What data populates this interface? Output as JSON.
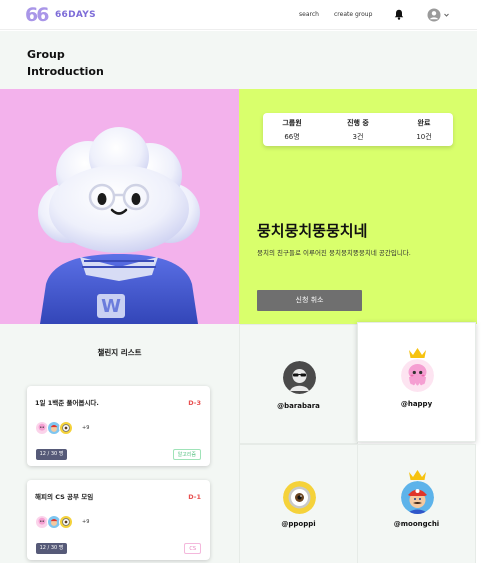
{
  "header": {
    "logo_mark": "66",
    "logo_text": "66DAYS",
    "nav_search": "search",
    "nav_create_group": "create group",
    "bell_icon": "bell-icon",
    "profile_icon": "user-avatar-icon",
    "profile_caret": "chevron-down-icon"
  },
  "page": {
    "title": "Group\nIntroduction"
  },
  "group": {
    "stats": [
      {
        "label": "그룹원",
        "value": "66명"
      },
      {
        "label": "진행 중",
        "value": "3건"
      },
      {
        "label": "완료",
        "value": "10건"
      }
    ],
    "name": "뭉치뭉치뚱뭉치네",
    "description": "뭉치의 친구들로 이루어진 뭉치뭉치뚱뭉치네 공간입니다.",
    "cancel_label": "신청 취소",
    "hero_image": "cloud-character-image"
  },
  "challenges": {
    "heading": "챌린지 리스트",
    "items": [
      {
        "title": "1일 1백준 풀어봅시다.",
        "dday": "D-3",
        "more": "+9",
        "count": "12 / 30 명",
        "tag": "알고리즘"
      },
      {
        "title": "해피의 CS 공부 모임",
        "dday": "D-1",
        "more": "+9",
        "count": "12 / 30 명",
        "tag": "CS"
      }
    ]
  },
  "members": [
    {
      "name": "@barabara",
      "leader": false,
      "avatar": "sunglasses-avatar-icon"
    },
    {
      "name": "@happy",
      "leader": true,
      "avatar": "octopus-avatar-icon"
    },
    {
      "name": "@ppoppi",
      "leader": false,
      "avatar": "minion-eye-avatar-icon"
    },
    {
      "name": "@moongchi",
      "leader": true,
      "avatar": "mario-avatar-icon"
    }
  ],
  "colors": {
    "accent_purple": "#7d6cd8",
    "hero_pink": "#f3b2ec",
    "info_green": "#d9ff6c",
    "dday_red": "#e84f4f",
    "button_gray": "#6f6f6f",
    "badge_navy": "#565a78",
    "crown_yellow": "#f6c20f"
  }
}
